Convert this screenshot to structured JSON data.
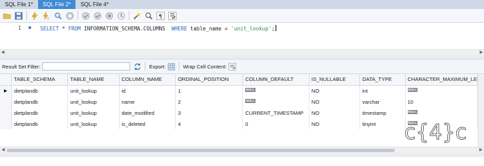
{
  "tabs": [
    {
      "label": "SQL File 1*",
      "active": false
    },
    {
      "label": "SQL File 2*",
      "active": true
    },
    {
      "label": "SQL File 4*",
      "active": false
    }
  ],
  "toolbar": {
    "icons": [
      "open-folder-icon",
      "save-icon",
      "execute-icon",
      "execute-line-icon",
      "explain-icon",
      "stop-icon",
      "toggle-continue-icon",
      "commit-icon",
      "rollback-icon",
      "autocommit-icon",
      "beautify-icon",
      "find-icon",
      "invisible-chars-icon",
      "wrap-lines-icon"
    ]
  },
  "editor": {
    "line_number": "1",
    "code": {
      "select": "SELECT",
      "star": " * ",
      "from": "FROM",
      "schema": " INFORMATION_SCHEMA.COLUMNS",
      "where": "  WHERE",
      "col": " table_name",
      "eq": " = ",
      "str": "'unit_lookup'",
      "semi": ";"
    }
  },
  "result_bar": {
    "filter_label": "Result Set Filter:",
    "filter_value": "",
    "export_label": "Export:",
    "wrap_label": "Wrap Cell Content:"
  },
  "grid": {
    "null_text": "NULL",
    "columns": [
      "TABLE_SCHEMA",
      "TABLE_NAME",
      "COLUMN_NAME",
      "ORDINAL_POSITION",
      "COLUMN_DEFAULT",
      "IS_NULLABLE",
      "DATA_TYPE",
      "CHARACTER_MAXIMUM_LE"
    ],
    "rows": [
      [
        "dietplandb",
        "unit_lookup",
        "id",
        "1",
        null,
        "NO",
        "int",
        null
      ],
      [
        "dietplandb",
        "unit_lookup",
        "name",
        "2",
        null,
        "NO",
        "varchar",
        "10"
      ],
      [
        "dietplandb",
        "unit_lookup",
        "date_modified",
        "3",
        "CURRENT_TIMESTAMP",
        "NO",
        "timestamp",
        null
      ],
      [
        "dietplandb",
        "unit_lookup",
        "is_deleted",
        "4",
        "0",
        "NO",
        "tinyint",
        null
      ]
    ],
    "current_row_marker": "▶"
  },
  "watermark": {
    "text": "c{4}c"
  },
  "colors": {
    "active_tab": "#3f8ad4",
    "tabbar": "#cfd8e6",
    "keyword": "#2a61b7",
    "string": "#2e8b57",
    "null_badge": "#8a8a8a"
  }
}
